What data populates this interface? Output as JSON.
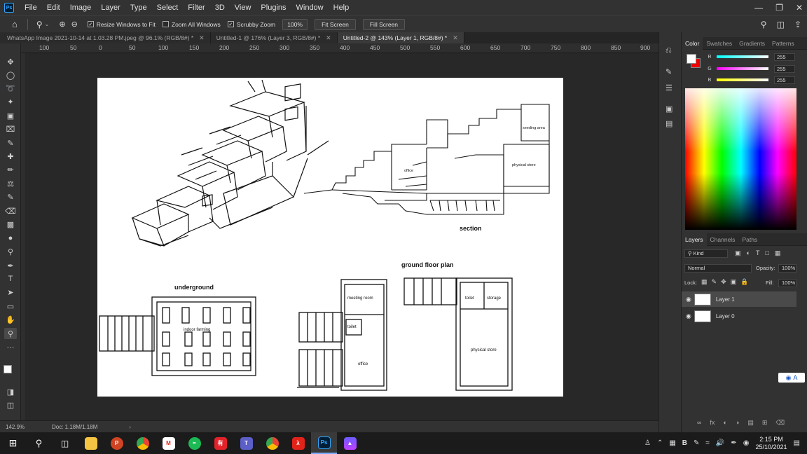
{
  "app": {
    "logo": "Ps",
    "menu": [
      "File",
      "Edit",
      "Image",
      "Layer",
      "Type",
      "Select",
      "Filter",
      "3D",
      "View",
      "Plugins",
      "Window",
      "Help"
    ]
  },
  "options": {
    "resize_windows": "Resize Windows to Fit",
    "zoom_all": "Zoom All Windows",
    "scrubby": "Scrubby Zoom",
    "zoom_value": "100%",
    "fit_screen": "Fit Screen",
    "fill_screen": "Fill Screen"
  },
  "tabs": [
    {
      "label": "WhatsApp Image 2021-10-14 at 1.03.28 PM.jpeg @ 96.1% (RGB/8#) *"
    },
    {
      "label": "Untitled-1 @ 176% (Layer 3, RGB/8#) *"
    },
    {
      "label": "Untitled-2 @ 143% (Layer 1, RGB/8#) *"
    }
  ],
  "ruler": [
    "100",
    "50",
    "0",
    "50",
    "100",
    "150",
    "200",
    "250",
    "300",
    "350",
    "400",
    "450",
    "500",
    "550",
    "600",
    "650",
    "700",
    "750",
    "800",
    "850",
    "900"
  ],
  "drawing": {
    "section": "section",
    "ground_floor_plan": "ground floor plan",
    "underground": "underground",
    "indoor_farming": "indoor farming",
    "meeting_room": "meeting room",
    "toilet": "toilet",
    "office": "office",
    "storage": "storage",
    "physical_store": "physical store",
    "seeding_area": "seeding area"
  },
  "status": {
    "zoom": "142.9%",
    "doc": "Doc: 1.18M/1.18M"
  },
  "color_panel": {
    "tabs": [
      "Color",
      "Swatches",
      "Gradients",
      "Patterns"
    ],
    "r_label": "R",
    "g_label": "G",
    "b_label": "B",
    "r": "255",
    "g": "255",
    "b": "255"
  },
  "layers_panel": {
    "tabs": [
      "Layers",
      "Channels",
      "Paths"
    ],
    "kind": "Kind",
    "blend": "Normal",
    "opacity_label": "Opacity:",
    "opacity": "100%",
    "lock_label": "Lock:",
    "fill_label": "Fill:",
    "fill": "100%",
    "layers": [
      {
        "name": "Layer 1"
      },
      {
        "name": "Layer 0"
      }
    ]
  },
  "taskbar": {
    "time": "2:15 PM",
    "date": "25/10/2021"
  }
}
